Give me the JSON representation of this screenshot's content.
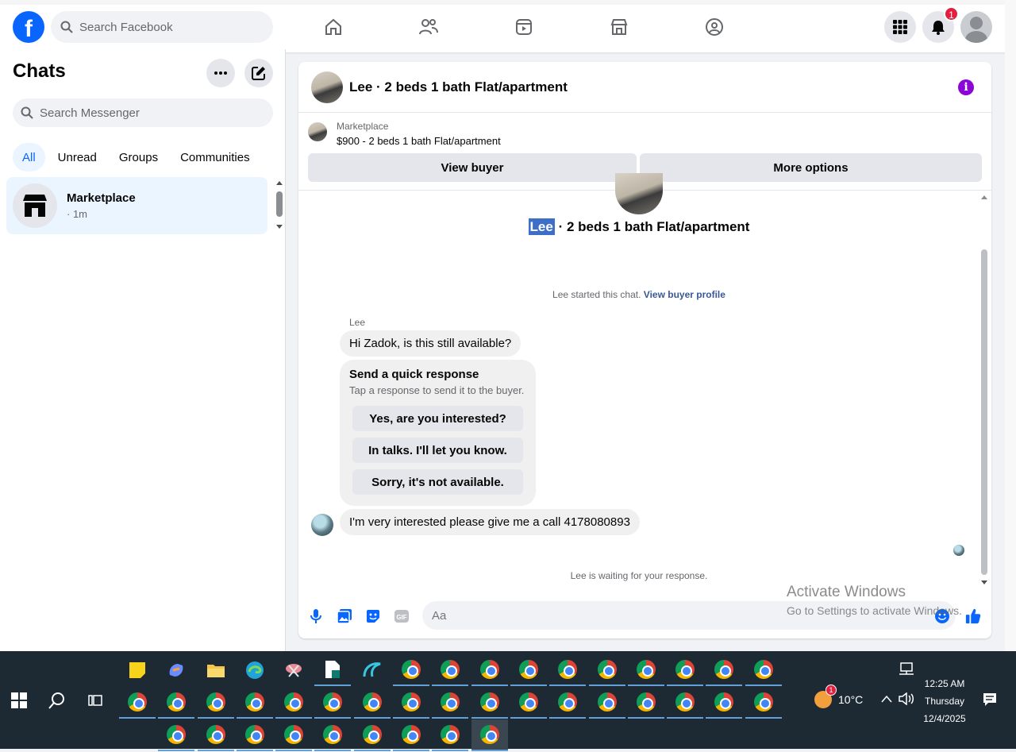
{
  "topbar": {
    "logo": "f",
    "search_placeholder": "Search Facebook",
    "notifications_count": "1",
    "nav_icons": [
      "home-icon",
      "friends-icon",
      "video-icon",
      "marketplace-icon",
      "groups-icon"
    ]
  },
  "sidebar": {
    "title": "Chats",
    "search_placeholder": "Search Messenger",
    "filters": [
      "All",
      "Unread",
      "Groups",
      "Communities"
    ],
    "chat": {
      "name": "Marketplace",
      "time": "· 1m"
    }
  },
  "conversation": {
    "title": "Lee · 2 beds 1 bath Flat/apartment",
    "marketplace_label": "Marketplace",
    "listing": "$900 - 2 beds 1 bath Flat/apartment",
    "view_buyer": "View buyer",
    "more_options": "More options",
    "hero_name": "Lee",
    "hero_rest": "· 2 beds 1 bath Flat/apartment",
    "started_text": "Lee started this chat.",
    "view_buyer_profile": "View buyer profile",
    "sender": "Lee",
    "first_message": "Hi Zadok, is this still available?",
    "quick_title": "Send a quick response",
    "quick_sub": "Tap a response to send it to the buyer.",
    "quick_responses": [
      "Yes, are you interested?",
      "In talks. I'll let you know.",
      "Sorry, it's not available."
    ],
    "second_message": "I'm very interested please give me a call 4178080893",
    "waiting": "Lee is waiting for your response.",
    "composer_placeholder": "Aa"
  },
  "watermark": {
    "line1": "Activate Windows",
    "line2": "Go to Settings to activate Windows."
  },
  "taskbar": {
    "temperature": "10°C",
    "weather_badge": "1",
    "time": "12:25 AM",
    "day": "Thursday",
    "date": "12/4/2025"
  },
  "colors": {
    "brand": "#0866ff",
    "accent_purple": "#8a06d6",
    "taskbar": "#1e2a33"
  }
}
